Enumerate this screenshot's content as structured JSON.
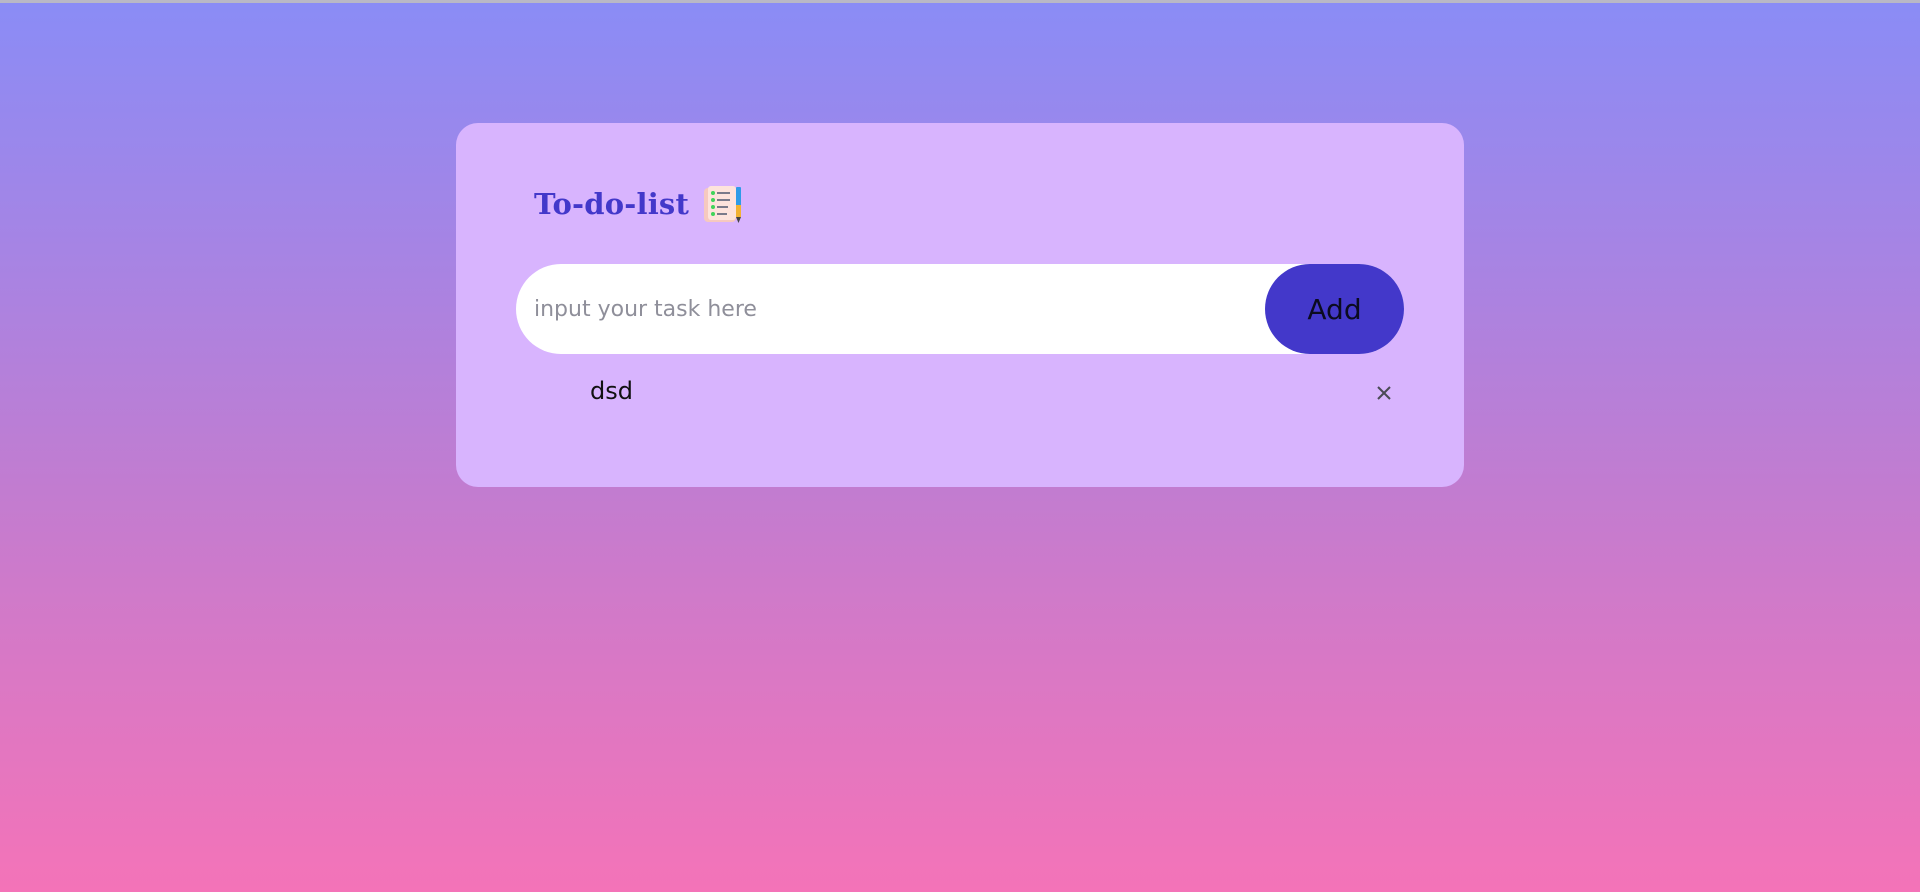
{
  "app": {
    "title": "To-do-list"
  },
  "input": {
    "placeholder": "input your task here",
    "value": "",
    "add_label": "Add"
  },
  "tasks": [
    {
      "text": "dsd",
      "remove_icon": "close-icon"
    }
  ],
  "colors": {
    "card_background": "#d8b4fe",
    "accent": "#4338ca",
    "gradient_top": "#8a8cf6",
    "gradient_bottom": "#f473b8"
  },
  "icons": {
    "title_icon": "list-notepad-icon"
  }
}
